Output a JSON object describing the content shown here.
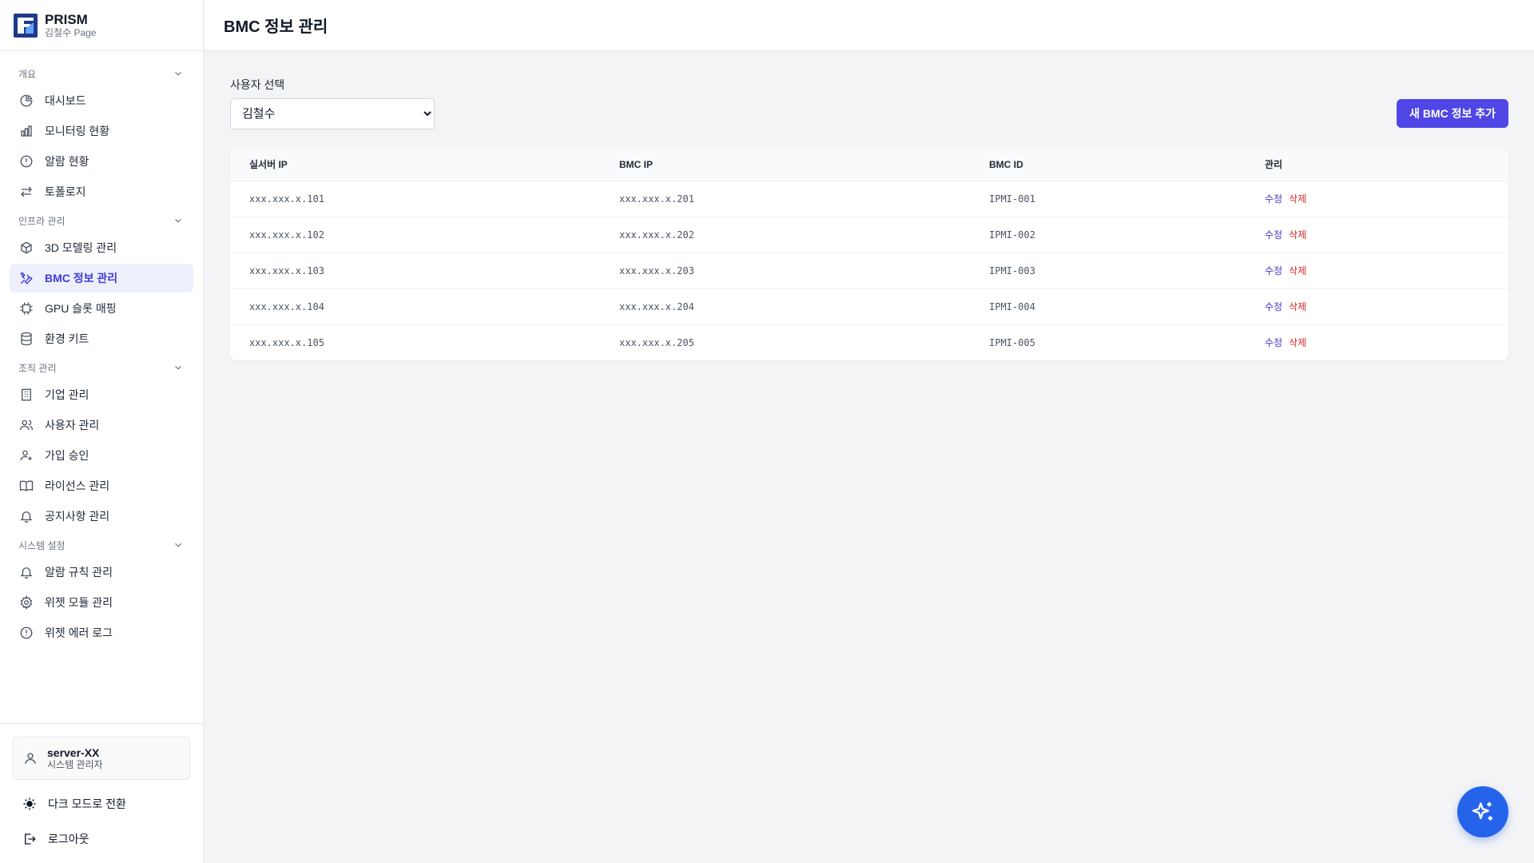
{
  "brand": {
    "title": "PRISM",
    "subtitle": "김철수 Page"
  },
  "page_title": "BMC 정보 관리",
  "sidebar": {
    "sections": [
      {
        "label": "개요",
        "items": [
          {
            "label": "대시보드",
            "icon": "pie-chart-icon"
          },
          {
            "label": "모니터링 현황",
            "icon": "bar-chart-icon"
          },
          {
            "label": "알람 현황",
            "icon": "alert-circle-icon"
          },
          {
            "label": "토폴로지",
            "icon": "arrows-left-right-icon"
          }
        ]
      },
      {
        "label": "인프라 관리",
        "items": [
          {
            "label": "3D 모델링 관리",
            "icon": "cube-icon"
          },
          {
            "label": "BMC 정보 관리",
            "icon": "wrench-icon",
            "active": true
          },
          {
            "label": "GPU 슬롯 매핑",
            "icon": "cpu-icon"
          },
          {
            "label": "환경 키트",
            "icon": "database-icon"
          }
        ]
      },
      {
        "label": "조직 관리",
        "items": [
          {
            "label": "기업 관리",
            "icon": "building-icon"
          },
          {
            "label": "사용자 관리",
            "icon": "users-icon"
          },
          {
            "label": "가입 승인",
            "icon": "user-plus-icon"
          },
          {
            "label": "라이선스 관리",
            "icon": "book-icon"
          },
          {
            "label": "공지사항 관리",
            "icon": "bell-icon"
          }
        ]
      },
      {
        "label": "시스템 설정",
        "items": [
          {
            "label": "알람 규칙 관리",
            "icon": "bell-icon"
          },
          {
            "label": "위젯 모듈 관리",
            "icon": "gear-icon"
          },
          {
            "label": "위젯 에러 로그",
            "icon": "alert-circle-icon"
          }
        ]
      }
    ]
  },
  "user": {
    "name": "server-XX",
    "role": "시스템 관리자"
  },
  "footer": {
    "dark_mode": "다크 모드로 전환",
    "logout": "로그아웃"
  },
  "filter": {
    "label": "사용자 선택",
    "selected": "김철수"
  },
  "add_button": "새 BMC 정보 추가",
  "table": {
    "headers": [
      "실서버 IP",
      "BMC IP",
      "BMC ID",
      "관리"
    ],
    "rows": [
      {
        "server_ip": "xxx.xxx.x.101",
        "bmc_ip": "xxx.xxx.x.201",
        "bmc_id": "IPMI-001"
      },
      {
        "server_ip": "xxx.xxx.x.102",
        "bmc_ip": "xxx.xxx.x.202",
        "bmc_id": "IPMI-002"
      },
      {
        "server_ip": "xxx.xxx.x.103",
        "bmc_ip": "xxx.xxx.x.203",
        "bmc_id": "IPMI-003"
      },
      {
        "server_ip": "xxx.xxx.x.104",
        "bmc_ip": "xxx.xxx.x.204",
        "bmc_id": "IPMI-004"
      },
      {
        "server_ip": "xxx.xxx.x.105",
        "bmc_ip": "xxx.xxx.x.205",
        "bmc_id": "IPMI-005"
      }
    ],
    "edit_label": "수정",
    "delete_label": "삭제"
  },
  "colors": {
    "accent": "#4f46e5",
    "active_bg": "#eef0fc",
    "delete": "#dc2626",
    "fab": "#2563eb"
  }
}
